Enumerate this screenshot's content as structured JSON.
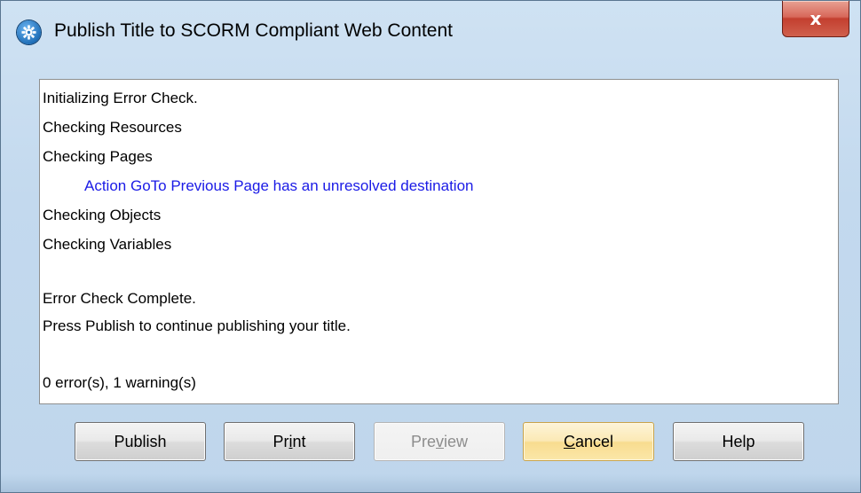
{
  "window": {
    "title": "Publish Title to SCORM Compliant Web Content",
    "icon": "gear-icon",
    "close_label": "x"
  },
  "log": [
    {
      "text": "Initializing Error Check.",
      "type": "normal"
    },
    {
      "text": "Checking Resources",
      "type": "normal"
    },
    {
      "text": "Checking Pages",
      "type": "normal"
    },
    {
      "text": "Action GoTo Previous Page has an unresolved destination",
      "type": "warning"
    },
    {
      "text": "Checking Objects",
      "type": "normal"
    },
    {
      "text": "Checking Variables",
      "type": "normal"
    },
    {
      "text": "",
      "type": "blank"
    },
    {
      "text": "Error Check Complete.",
      "type": "normal"
    },
    {
      "text": "Press Publish to continue publishing your title.",
      "type": "normal"
    },
    {
      "text": "",
      "type": "blank"
    },
    {
      "text": "0 error(s), 1 warning(s)",
      "type": "normal"
    }
  ],
  "buttons": {
    "publish": "Publish",
    "print_pre": "Pr",
    "print_key": "i",
    "print_post": "nt",
    "preview_pre": "Pre",
    "preview_key": "v",
    "preview_post": "iew",
    "cancel_key": "C",
    "cancel_post": "ancel",
    "help": "Help"
  },
  "colors": {
    "warning_text": "#1a1ae6",
    "default_button": "#f8dc8f",
    "close_button": "#c33f2f"
  }
}
